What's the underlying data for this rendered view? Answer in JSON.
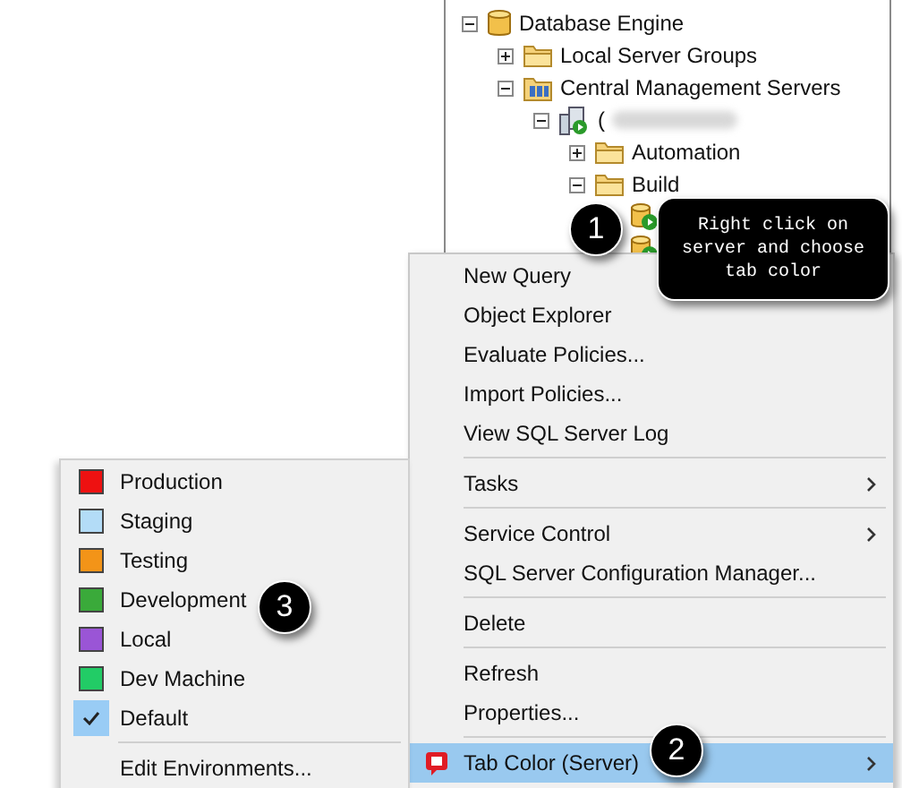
{
  "tree": [
    {
      "label": "Database Engine",
      "kind": "database",
      "expanded": true,
      "children": [
        {
          "label": "Local Server Groups",
          "kind": "folder",
          "expanded": false
        },
        {
          "label": "Central Management Servers",
          "kind": "server-group",
          "expanded": true,
          "children": [
            {
              "label": "(",
              "kind": "server",
              "expanded": true,
              "redacted": true,
              "children": [
                {
                  "label": "Automation",
                  "kind": "folder",
                  "expanded": false
                },
                {
                  "label": "Build",
                  "kind": "folder",
                  "expanded": true,
                  "children": [
                    {
                      "kind": "db-server"
                    },
                    {
                      "kind": "db-server"
                    }
                  ]
                }
              ]
            }
          ]
        }
      ]
    }
  ],
  "context_menu": [
    {
      "kind": "item",
      "label": "New Query",
      "submenu": false,
      "selected": false
    },
    {
      "kind": "item",
      "label": "Object Explorer",
      "submenu": false,
      "selected": false
    },
    {
      "kind": "item",
      "label": "Evaluate Policies...",
      "submenu": false,
      "selected": false
    },
    {
      "kind": "item",
      "label": "Import Policies...",
      "submenu": false,
      "selected": false
    },
    {
      "kind": "item",
      "label": "View SQL Server Log",
      "submenu": false,
      "selected": false
    },
    {
      "kind": "separator"
    },
    {
      "kind": "item",
      "label": "Tasks",
      "submenu": true,
      "selected": false
    },
    {
      "kind": "separator"
    },
    {
      "kind": "item",
      "label": "Service Control",
      "submenu": true,
      "selected": false
    },
    {
      "kind": "item",
      "label": "SQL Server Configuration Manager...",
      "submenu": false,
      "selected": false
    },
    {
      "kind": "separator"
    },
    {
      "kind": "item",
      "label": "Delete",
      "submenu": false,
      "selected": false
    },
    {
      "kind": "separator"
    },
    {
      "kind": "item",
      "label": "Refresh",
      "submenu": false,
      "selected": false
    },
    {
      "kind": "item",
      "label": "Properties...",
      "submenu": false,
      "selected": false
    },
    {
      "kind": "separator"
    },
    {
      "kind": "colored-item",
      "label": "Tab Color (Server)",
      "submenu": true,
      "selected": true
    }
  ],
  "color_submenu": [
    {
      "kind": "swatch",
      "label": "Production",
      "color": "#ee1111",
      "checked": false
    },
    {
      "kind": "swatch",
      "label": "Staging",
      "color": "#b3dcf7",
      "checked": false
    },
    {
      "kind": "swatch",
      "label": "Testing",
      "color": "#f39418",
      "checked": false
    },
    {
      "kind": "swatch",
      "label": "Development",
      "color": "#3aaa3a",
      "checked": false
    },
    {
      "kind": "swatch",
      "label": "Local",
      "color": "#9a55d6",
      "checked": false
    },
    {
      "kind": "swatch",
      "label": "Dev Machine",
      "color": "#22cc66",
      "checked": false
    },
    {
      "kind": "swatch",
      "label": "Default",
      "checked": true
    },
    {
      "kind": "separator"
    },
    {
      "kind": "item",
      "label": "Edit Environments..."
    }
  ],
  "callouts": [
    {
      "number": "1",
      "text": "Right click on server and choose tab color"
    },
    {
      "number": "2"
    },
    {
      "number": "3"
    }
  ]
}
